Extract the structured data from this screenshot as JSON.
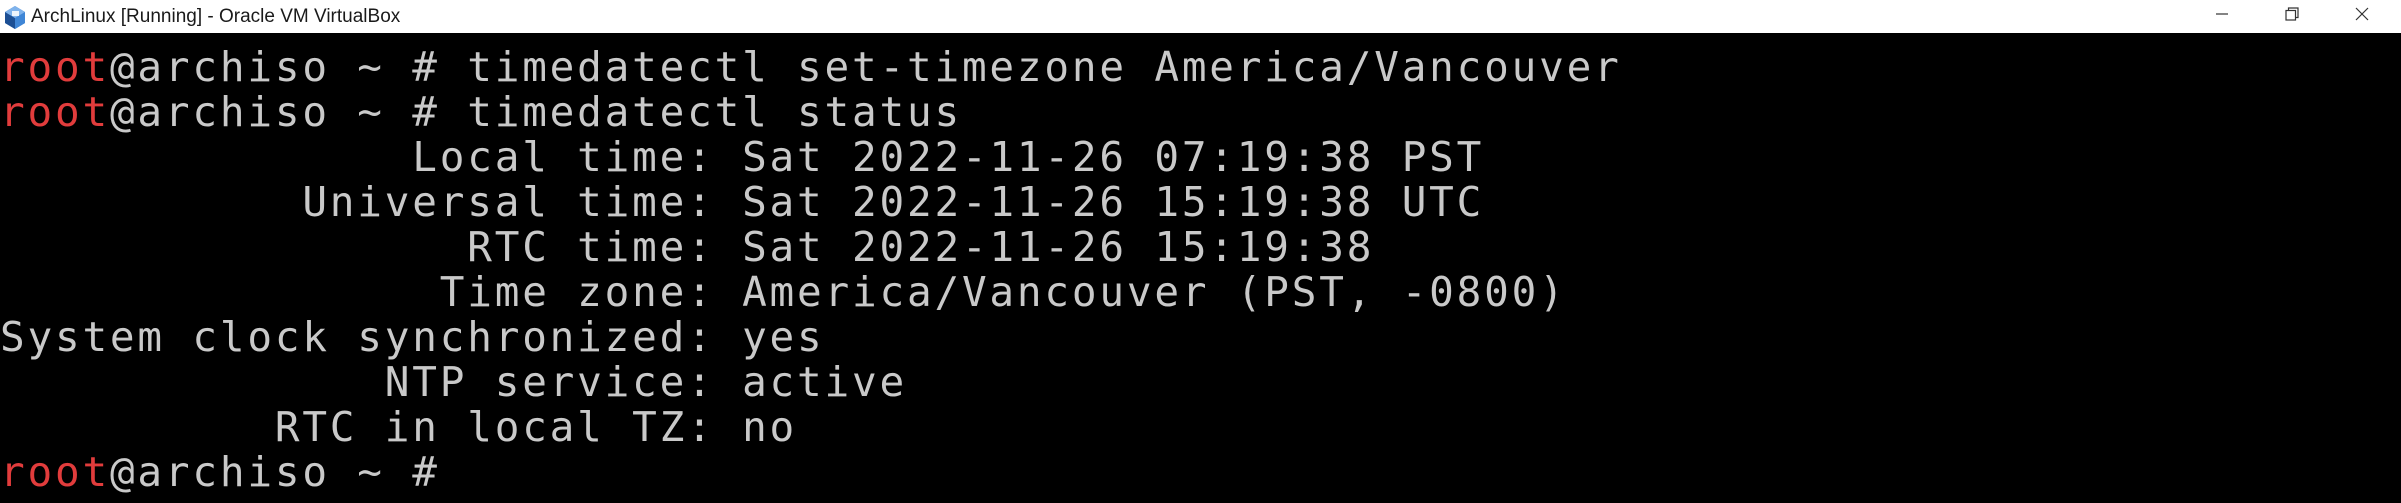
{
  "window": {
    "title": "ArchLinux [Running] - Oracle VM VirtualBox"
  },
  "colors": {
    "prompt_user": "#e13c3c",
    "terminal_text": "#c9c9c9",
    "terminal_bg": "#000000",
    "titlebar_bg": "#ffffff"
  },
  "terminal": {
    "lines": [
      {
        "user": "root",
        "rest": "@archiso ~ # timedatectl set-timezone America/Vancouver"
      },
      {
        "user": "root",
        "rest": "@archiso ~ # timedatectl status"
      },
      {
        "text": "               Local time: Sat 2022-11-26 07:19:38 PST"
      },
      {
        "text": "           Universal time: Sat 2022-11-26 15:19:38 UTC"
      },
      {
        "text": "                 RTC time: Sat 2022-11-26 15:19:38"
      },
      {
        "text": "                Time zone: America/Vancouver (PST, -0800)"
      },
      {
        "text": "System clock synchronized: yes"
      },
      {
        "text": "              NTP service: active"
      },
      {
        "text": "          RTC in local TZ: no"
      },
      {
        "user": "root",
        "rest": "@archiso ~ # "
      }
    ]
  }
}
